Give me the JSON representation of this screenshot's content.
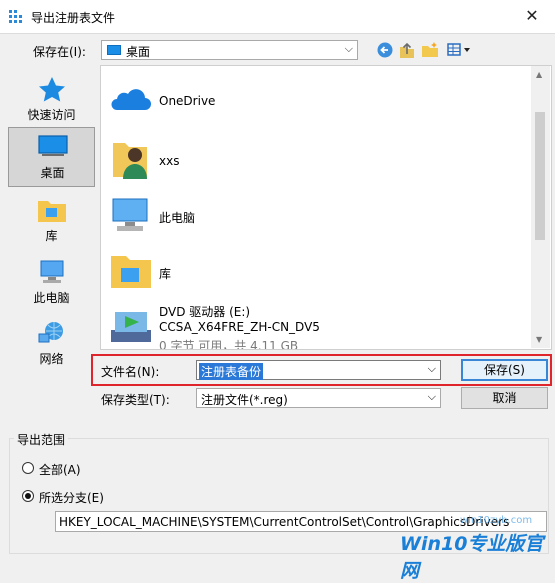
{
  "window": {
    "title": "导出注册表文件",
    "close_glyph": "✕"
  },
  "toolbar": {
    "save_in_label": "保存在(I):",
    "location": "桌面",
    "buttons": [
      "back-icon",
      "up-folder-icon",
      "new-folder-icon",
      "view-menu-icon"
    ]
  },
  "places": [
    {
      "label": "快速访问",
      "icon": "quick-access-icon"
    },
    {
      "label": "桌面",
      "icon": "desktop-icon",
      "selected": true
    },
    {
      "label": "库",
      "icon": "library-icon"
    },
    {
      "label": "此电脑",
      "icon": "this-pc-icon"
    },
    {
      "label": "网络",
      "icon": "network-icon"
    }
  ],
  "files": [
    {
      "name": "OneDrive",
      "icon": "onedrive-icon"
    },
    {
      "name": "xxs",
      "icon": "user-folder-icon"
    },
    {
      "name": "此电脑",
      "icon": "this-pc-icon"
    },
    {
      "name": "库",
      "icon": "library-icon"
    },
    {
      "name": "DVD 驱动器 (E:)",
      "line2": "CCSA_X64FRE_ZH-CN_DV5",
      "line3": "0 字节 可用，共 4.11 GB",
      "icon": "dvd-drive-icon"
    }
  ],
  "filename": {
    "label": "文件名(N):",
    "value": "注册表备份"
  },
  "filetype": {
    "label": "保存类型(T):",
    "value": "注册文件(*.reg)"
  },
  "actions": {
    "save": "保存(S)",
    "cancel": "取消"
  },
  "export_range": {
    "title": "导出范围",
    "all": "全部(A)",
    "selected_branch": "所选分支(E)",
    "selected": "selected_branch",
    "path": "HKEY_LOCAL_MACHINE\\SYSTEM\\CurrentControlSet\\Control\\GraphicsDrivers"
  },
  "watermark": {
    "url": "win10zyb.com",
    "text": "Win10专业版官网"
  },
  "colors": {
    "accent": "#3a86d6",
    "highlight": "#e0242c",
    "selection": "#2a79d8"
  }
}
